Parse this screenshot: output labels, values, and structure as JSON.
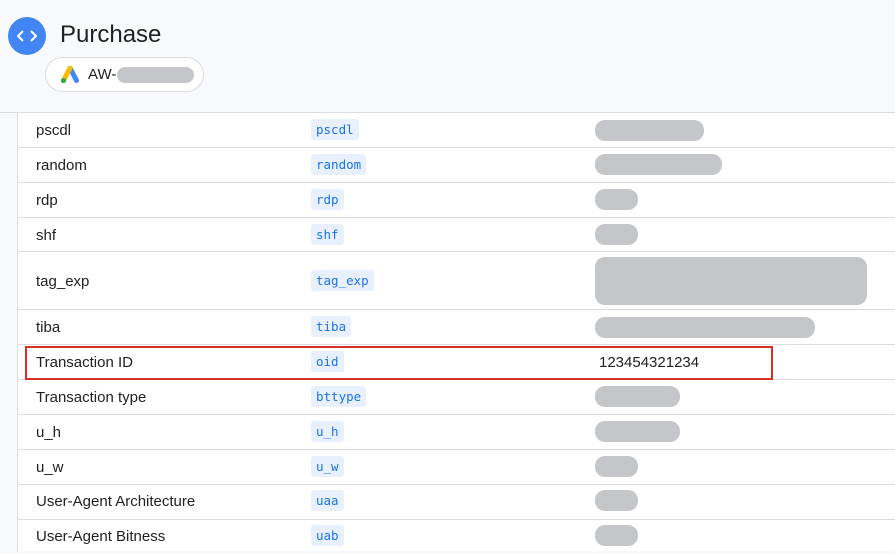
{
  "header": {
    "title": "Purchase",
    "account_prefix": "AW-"
  },
  "rows": [
    {
      "name": "pscdl",
      "key": "pscdl"
    },
    {
      "name": "random",
      "key": "random"
    },
    {
      "name": "rdp",
      "key": "rdp"
    },
    {
      "name": "shf",
      "key": "shf"
    },
    {
      "name": "tag_exp",
      "key": "tag_exp"
    },
    {
      "name": "tiba",
      "key": "tiba"
    },
    {
      "name": "Transaction ID",
      "key": "oid",
      "value": "123454321234"
    },
    {
      "name": "Transaction type",
      "key": "bttype"
    },
    {
      "name": "u_h",
      "key": "u_h"
    },
    {
      "name": "u_w",
      "key": "u_w"
    },
    {
      "name": "User-Agent Architecture",
      "key": "uaa"
    },
    {
      "name": "User-Agent Bitness",
      "key": "uab"
    }
  ],
  "colors": {
    "accent": "#4285f4",
    "key_text": "#1a73e8",
    "highlight": "#d93025",
    "redaction": "#c4c6c9"
  }
}
